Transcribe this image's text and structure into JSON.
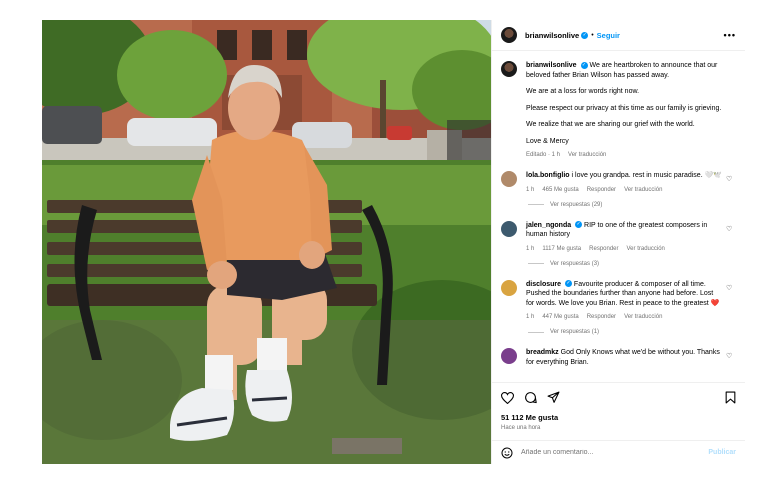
{
  "post": {
    "username": "brianwilsonlive",
    "follow_label": "Seguir",
    "more": "•••",
    "caption_paragraphs": [
      "We are at a loss for words right now.",
      "Please respect our privacy at this time as our family is grieving.",
      "We realize that we are sharing our grief with the world.",
      "Love & Mercy"
    ],
    "caption_first": "We are heartbroken to announce that our beloved father Brian Wilson has passed away.",
    "caption_meta_edited": "Editado · 1 h",
    "caption_meta_translate": "Ver traducción"
  },
  "comments": [
    {
      "user": "lola.bonfiglio",
      "verified": false,
      "text": "i love you grandpa. rest in music paradise. 🤍🕊️",
      "time": "1 h",
      "likes": "465 Me gusta",
      "reply": "Responder",
      "translate": "Ver traducción",
      "replies": "Ver respuestas (29)",
      "avatar_color": "#b08a6a"
    },
    {
      "user": "jalen_ngonda",
      "verified": true,
      "text": "RIP to one of the greatest composers in human history",
      "time": "1 h",
      "likes": "1117 Me gusta",
      "reply": "Responder",
      "translate": "Ver traducción",
      "replies": "Ver respuestas (3)",
      "avatar_color": "#3d5a6e"
    },
    {
      "user": "disclosure",
      "verified": true,
      "text": "Favourite producer & composer of all time. Pushed the boundaries further than anyone had before. Lost for words. We love you Brian. Rest in peace to the greatest ❤️",
      "time": "1 h",
      "likes": "447 Me gusta",
      "reply": "Responder",
      "translate": "Ver traducción",
      "replies": "Ver respuestas (1)",
      "avatar_color": "#d9a441"
    },
    {
      "user": "breadmkz",
      "verified": false,
      "text": "God Only Knows what we'd be without you. Thanks for everything Brian.",
      "time": "",
      "likes": "",
      "reply": "",
      "translate": "",
      "replies": "",
      "avatar_color": "#7a3e8c"
    }
  ],
  "actions": {
    "icons": [
      "heart-icon",
      "comment-icon",
      "share-icon",
      "bookmark-icon"
    ],
    "likes": "51 112 Me gusta",
    "time_ago": "Hace una hora"
  },
  "comment_box": {
    "placeholder": "Añade un comentario...",
    "publish_label": "Publicar"
  },
  "colors": {
    "accent": "#0095f6",
    "muted": "#737373",
    "publish_disabled": "#b2dffc"
  }
}
